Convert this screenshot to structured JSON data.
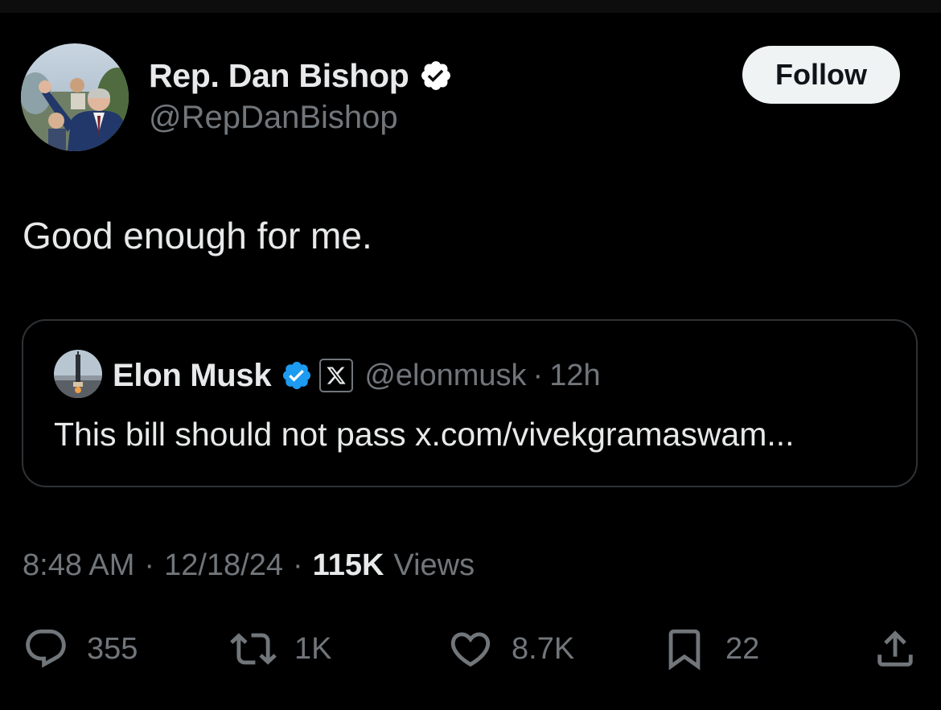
{
  "author": {
    "name": "Rep. Dan Bishop",
    "handle": "@RepDanBishop",
    "verified": true,
    "avatar": "politician-photo"
  },
  "follow_button": {
    "label": "Follow"
  },
  "tweet": {
    "text": "Good enough for me."
  },
  "quoted_tweet": {
    "name": "Elon Musk",
    "verified": true,
    "affiliation_badge": "X",
    "handle": "@elonmusk",
    "separator": "·",
    "time": "12h",
    "text": "This bill should not pass x.com/vivekgramaswam..."
  },
  "meta": {
    "time": "8:48 AM",
    "date": "12/18/24",
    "separator": "·",
    "views_count": "115K",
    "views_label": "Views"
  },
  "actions": {
    "replies": "355",
    "reposts": "1K",
    "likes": "8.7K",
    "bookmarks": "22"
  },
  "colors": {
    "background": "#000000",
    "text_primary": "#e7e9ea",
    "text_secondary": "#71767b",
    "verified_badge": "#1d9bf0",
    "border": "#2f3336",
    "follow_button_bg": "#eff3f4"
  },
  "icons": {
    "reply": "speech-bubble-icon",
    "repost": "repost-arrows-icon",
    "like": "heart-icon",
    "bookmark": "bookmark-icon",
    "share": "share-upload-icon"
  }
}
